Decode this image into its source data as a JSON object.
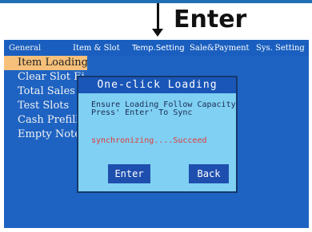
{
  "caption": {
    "label": "Enter"
  },
  "tabs": [
    {
      "label": "General",
      "active": true
    },
    {
      "label": "Item & Slot",
      "active": false
    },
    {
      "label": "Temp.Setting",
      "active": false
    },
    {
      "label": "Sale&Payment",
      "active": false
    },
    {
      "label": "Sys. Setting",
      "active": false
    }
  ],
  "menu": {
    "items": [
      {
        "label": "Item Loading",
        "selected": true
      },
      {
        "label": "Clear Slot Ei",
        "selected": false
      },
      {
        "label": "Total Sales",
        "selected": false
      },
      {
        "label": "Test Slots",
        "selected": false
      },
      {
        "label": "Cash Prefill",
        "selected": false
      },
      {
        "label": "Empty Note",
        "selected": false
      }
    ]
  },
  "dialog": {
    "title": "One-click Loading",
    "line1": "Ensure Loading Follow Capacity",
    "line2": "Press' Enter' To Sync",
    "status": "synchronizing....Succeed",
    "enter_label": "Enter",
    "back_label": "Back"
  },
  "colors": {
    "screen_bg": "#1e63c2",
    "selected_item": "#f6c07a",
    "dialog_bg": "#7fd0f2",
    "status_text": "#e23b3b"
  }
}
